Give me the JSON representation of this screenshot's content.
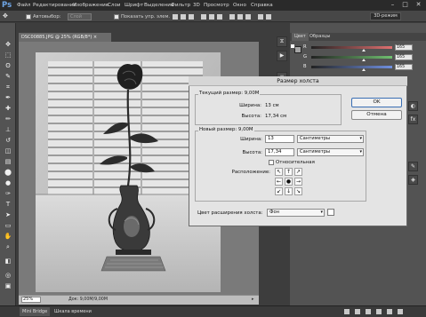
{
  "menu": {
    "logo": "Ps",
    "items": [
      "Файл",
      "Редактирование",
      "Изображение",
      "Слои",
      "Шрифт",
      "Выделение",
      "Фильтр",
      "3D",
      "Просмотр",
      "Окно",
      "Справка"
    ]
  },
  "options_bar": {
    "autoselect_label": "Автовыбор:",
    "autoselect_value": "Слой",
    "show_controls_label": "Показать упр. элем.",
    "workspace": "3D-режим"
  },
  "tools": {
    "icons": [
      "move-icon",
      "marquee-icon",
      "lasso-icon",
      "quick-select-icon",
      "crop-icon",
      "eyedropper-icon",
      "healing-icon",
      "brush-icon",
      "stamp-icon",
      "history-brush-icon",
      "eraser-icon",
      "gradient-icon",
      "blur-icon",
      "dodge-icon",
      "pen-icon",
      "type-icon",
      "path-select-icon",
      "shape-icon",
      "hand-icon",
      "zoom-icon",
      "colors-icon",
      "quickmask-icon",
      "screen-mode-icon"
    ],
    "glyphs": [
      "✥",
      "⬚",
      "ʘ",
      "✎",
      "⌗",
      "✒",
      "✚",
      "✏",
      "⊥",
      "↺",
      "◫",
      "▤",
      "⬤",
      "●",
      "✑",
      "T",
      "➤",
      "▭",
      "✋",
      "⌕",
      "◧",
      "◎",
      "▣"
    ]
  },
  "document": {
    "tab_title": "DSC00885.JPG @ 25% (RGB/8*) ×",
    "zoom": "25%",
    "doc_info": "Док: 9,00M/9,00M"
  },
  "bottom_tabs": [
    "Mini Bridge",
    "Шкала времени"
  ],
  "color_panel": {
    "tabs": [
      "Цвет",
      "Образцы"
    ],
    "sliders": [
      {
        "label": "R",
        "value": "165",
        "color": "#e07070",
        "knob": 0.647
      },
      {
        "label": "G",
        "value": "165",
        "color": "#70c070",
        "knob": 0.647
      },
      {
        "label": "B",
        "value": "165",
        "color": "#7090e0",
        "knob": 0.647
      }
    ]
  },
  "dialog": {
    "title": "Размер холста",
    "current_size": {
      "group_label": "Текущий размер: 9,00M",
      "width_label": "Ширина:",
      "width_value": "13 см",
      "height_label": "Высота:",
      "height_value": "17,34 см"
    },
    "new_size": {
      "group_label": "Новый размер: 9,00M",
      "width_label": "Ширина:",
      "width_value": "13",
      "width_unit": "Сантиметры",
      "height_label": "Высота:",
      "height_value": "17,34",
      "height_unit": "Сантиметры",
      "relative_label": "Относительная",
      "anchor_label": "Расположение:",
      "anchor_arrows": [
        "↖",
        "↑",
        "↗",
        "←",
        "●",
        "→",
        "↙",
        "↓",
        "↘"
      ]
    },
    "extension_color_label": "Цвет расширения холста:",
    "extension_color_value": "Фон",
    "ok_label": "OK",
    "cancel_label": "Отмена"
  },
  "colors": {
    "app_bg": "#3d3d3d",
    "panel_bg": "#535353",
    "dialog_bg": "#e4e4e4",
    "logo": "#6fa6e6"
  }
}
